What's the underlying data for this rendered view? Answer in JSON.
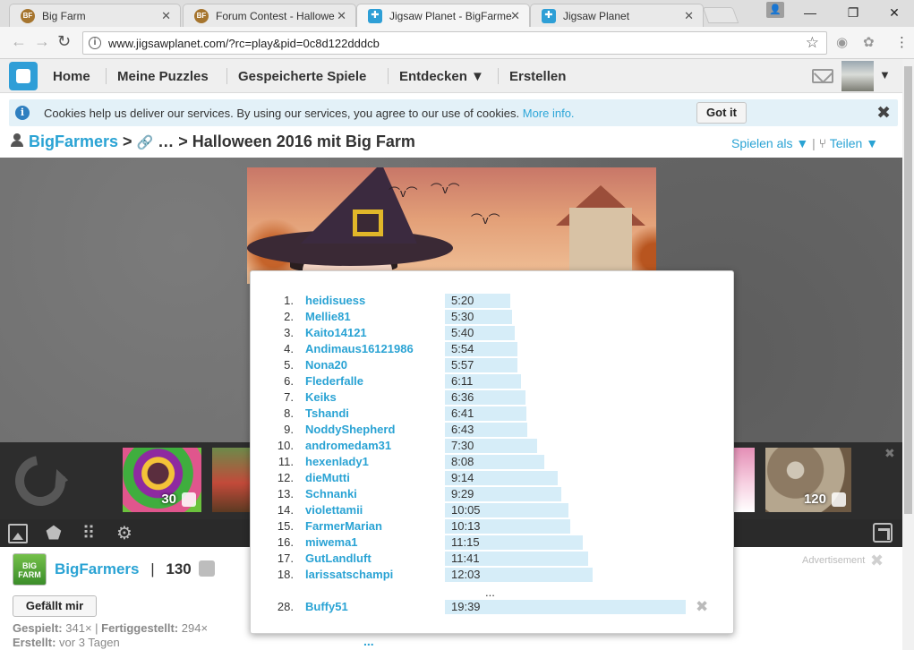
{
  "browser": {
    "tabs": [
      {
        "title": "Big Farm",
        "favicon": "BF",
        "active": false
      },
      {
        "title": "Forum Contest - Hallowe",
        "favicon": "BF",
        "active": false
      },
      {
        "title": "Jigsaw Planet - BigFarme",
        "favicon": "jigsaw-planet-icon",
        "active": true
      },
      {
        "title": "Jigsaw Planet",
        "favicon": "jigsaw-planet-icon",
        "active": false
      }
    ],
    "url": "www.jigsawplanet.com/?rc=play&pid=0c8d122dddcb"
  },
  "sitenav": {
    "items": [
      "Home",
      "Meine Puzzles",
      "Gespeicherte Spiele",
      "Entdecken ▼",
      "Erstellen"
    ]
  },
  "cookie": {
    "text": "Cookies help us deliver our services. By using our services, you agree to our use of cookies.",
    "more": "More info.",
    "button": "Got it"
  },
  "breadcrumb": {
    "user": "BigFarmers",
    "sep1": " > ",
    "ellipsis": " … > ",
    "title": "Halloween 2016 mit Big Farm"
  },
  "actions": {
    "play_as": "Spielen als ▼",
    "share": "Teilen ▼"
  },
  "thumbnails": [
    {
      "label": "30"
    },
    {
      "label": ""
    },
    {
      "label": ""
    },
    {
      "label": "120"
    }
  ],
  "author": {
    "logo_text": "BIG FARM",
    "name": "BigFarmers",
    "separator": "|",
    "count": "130"
  },
  "like_button": "Gefällt mir",
  "stats": {
    "played_label": "Gespielt:",
    "played_value": "341×",
    "completed_label": "Fertiggestellt:",
    "completed_value": "294×",
    "created_label": "Erstellt:",
    "created_value": "vor 3 Tagen",
    "more": "..."
  },
  "ad": {
    "label": "Advertisement"
  },
  "leaderboard": {
    "entries": [
      {
        "rank": "1.",
        "name": "heidisuess",
        "time": "5:20",
        "seconds": 320
      },
      {
        "rank": "2.",
        "name": "Mellie81",
        "time": "5:30",
        "seconds": 330
      },
      {
        "rank": "3.",
        "name": "Kaito14121",
        "time": "5:40",
        "seconds": 340
      },
      {
        "rank": "4.",
        "name": "Andimaus16121986",
        "time": "5:54",
        "seconds": 354
      },
      {
        "rank": "5.",
        "name": "Nona20",
        "time": "5:57",
        "seconds": 357
      },
      {
        "rank": "6.",
        "name": "Flederfalle",
        "time": "6:11",
        "seconds": 371
      },
      {
        "rank": "7.",
        "name": "Keiks",
        "time": "6:36",
        "seconds": 396
      },
      {
        "rank": "8.",
        "name": "Tshandi",
        "time": "6:41",
        "seconds": 401
      },
      {
        "rank": "9.",
        "name": "NoddyShepherd",
        "time": "6:43",
        "seconds": 403
      },
      {
        "rank": "10.",
        "name": "andromedam31",
        "time": "7:30",
        "seconds": 450
      },
      {
        "rank": "11.",
        "name": "hexenlady1",
        "time": "8:08",
        "seconds": 488
      },
      {
        "rank": "12.",
        "name": "dieMutti",
        "time": "9:14",
        "seconds": 554
      },
      {
        "rank": "13.",
        "name": "Schnanki",
        "time": "9:29",
        "seconds": 569
      },
      {
        "rank": "14.",
        "name": "violettamii",
        "time": "10:05",
        "seconds": 605
      },
      {
        "rank": "15.",
        "name": "FarmerMarian",
        "time": "10:13",
        "seconds": 613
      },
      {
        "rank": "16.",
        "name": "miwema1",
        "time": "11:15",
        "seconds": 675
      },
      {
        "rank": "17.",
        "name": "GutLandluft",
        "time": "11:41",
        "seconds": 701
      },
      {
        "rank": "18.",
        "name": "larissatschampi",
        "time": "12:03",
        "seconds": 723
      }
    ],
    "ellipsis": "...",
    "own": {
      "rank": "28.",
      "name": "Buffy51",
      "time": "19:39",
      "seconds": 1179
    }
  },
  "colors": {
    "accent": "#2aa3d4",
    "bar": "#d6edf8",
    "logo": "#2f9ed7"
  }
}
